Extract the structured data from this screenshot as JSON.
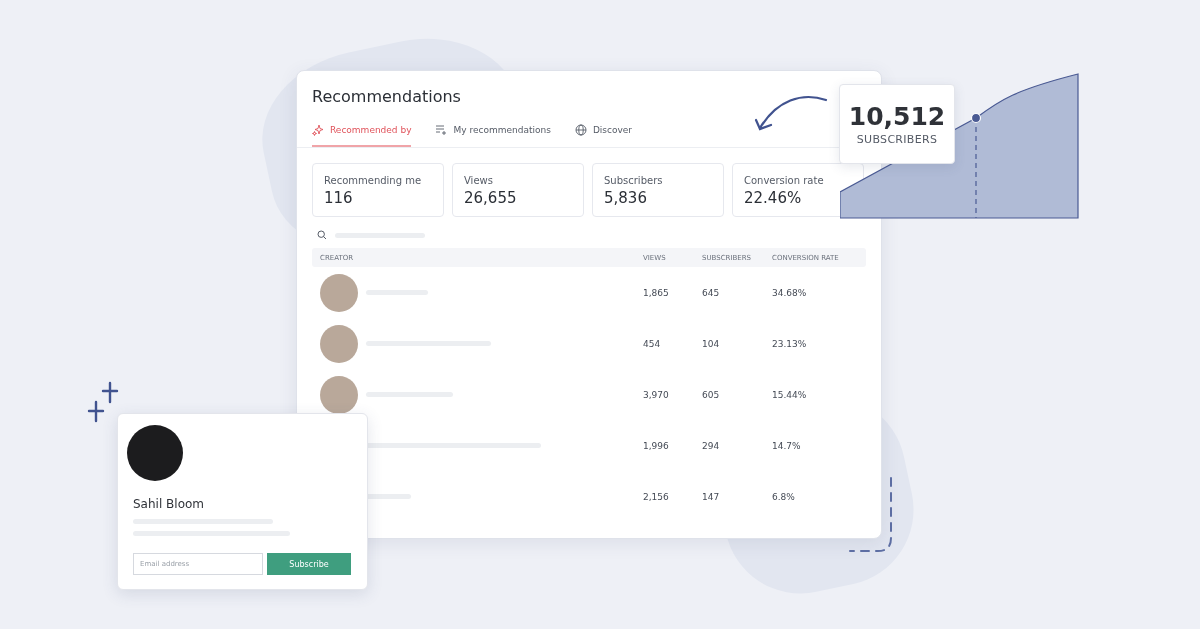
{
  "panel": {
    "title": "Recommendations",
    "tabs": [
      {
        "label": "Recommended by",
        "selected": true,
        "kind": "sparkle"
      },
      {
        "label": "My recommendations",
        "selected": false,
        "kind": "list"
      },
      {
        "label": "Discover",
        "selected": false,
        "kind": "globe"
      }
    ],
    "stats": [
      {
        "label": "Recommending me",
        "value": "116"
      },
      {
        "label": "Views",
        "value": "26,655"
      },
      {
        "label": "Subscribers",
        "value": "5,836"
      },
      {
        "label": "Conversion rate",
        "value": "22.46%"
      }
    ],
    "table": {
      "columns": [
        "CREATOR",
        "VIEWS",
        "SUBSCRIBERS",
        "CONVERSION RATE"
      ],
      "rows": [
        {
          "views": "1,865",
          "subscribers": "645",
          "conversion_rate": "34.68%"
        },
        {
          "views": "454",
          "subscribers": "104",
          "conversion_rate": "23.13%"
        },
        {
          "views": "3,970",
          "subscribers": "605",
          "conversion_rate": "15.44%"
        },
        {
          "views": "1,996",
          "subscribers": "294",
          "conversion_rate": "14.7%"
        },
        {
          "views": "2,156",
          "subscribers": "147",
          "conversion_rate": "6.8%"
        }
      ]
    }
  },
  "tooltip": {
    "value": "10,512",
    "label": "SUBSCRIBERS"
  },
  "profile": {
    "name": "Sahil Bloom",
    "email_placeholder": "Email address",
    "button": "Subscribe"
  }
}
